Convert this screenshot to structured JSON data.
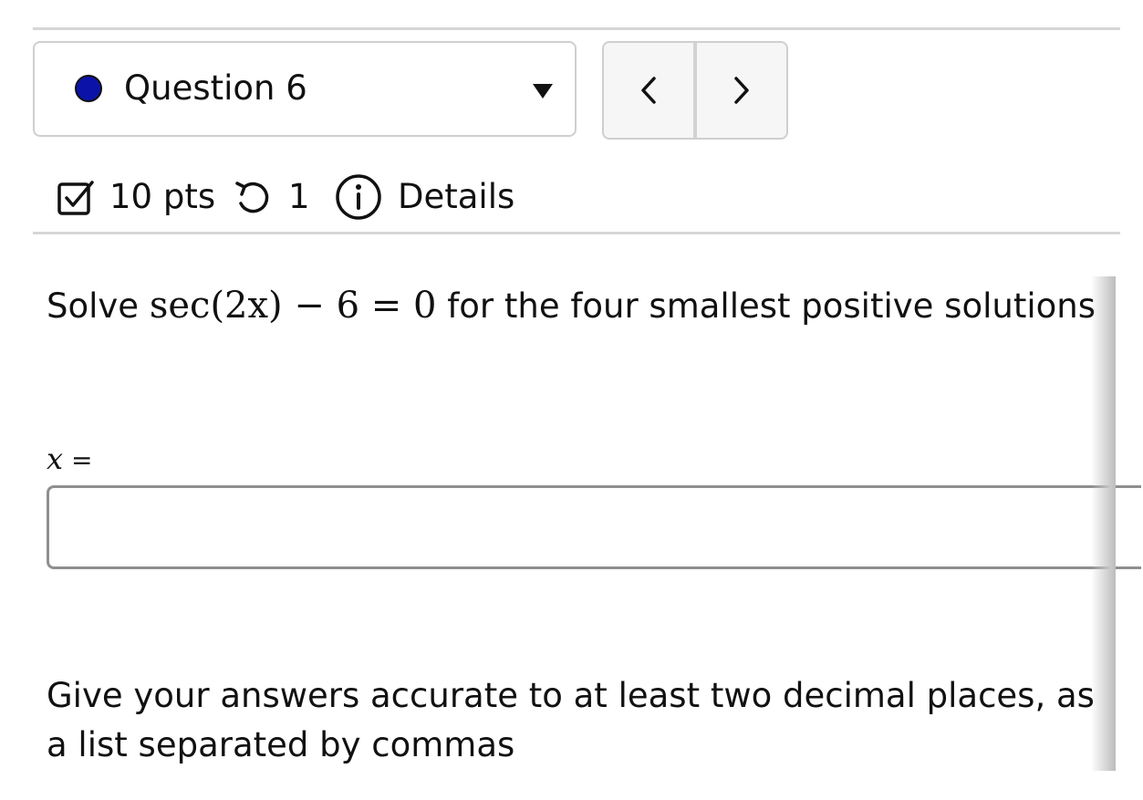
{
  "header": {
    "question_label": "Question 6",
    "status_dot_color": "#0b12a8",
    "prev_icon": "chevron-left-icon",
    "next_icon": "chevron-right-icon",
    "dropdown_icon": "caret-down-icon"
  },
  "meta": {
    "points": "10 pts",
    "attempts": "1",
    "details": "Details"
  },
  "question": {
    "intro": "Solve",
    "equation": "sec(2x) − 6 = 0",
    "outro": "for the four smallest positive solutions"
  },
  "answer": {
    "variable": "x",
    "equals": "=",
    "value": ""
  },
  "instructions": "Give your answers accurate to at least two decimal places, as a list separated by commas"
}
